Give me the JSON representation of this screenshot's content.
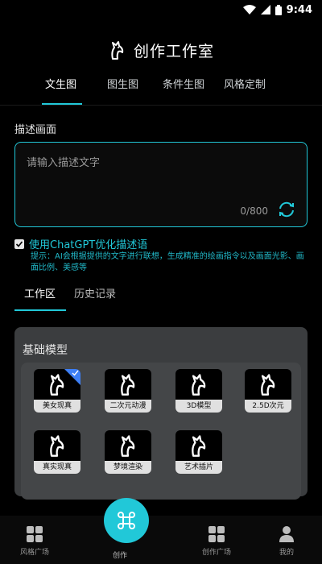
{
  "status_bar": {
    "time": "9:44"
  },
  "header": {
    "title": "创作工作室"
  },
  "tabs": [
    {
      "label": "文生图",
      "active": true
    },
    {
      "label": "图生图",
      "active": false
    },
    {
      "label": "条件生图",
      "active": false
    },
    {
      "label": "风格定制",
      "active": false
    }
  ],
  "description": {
    "section_label": "描述画面",
    "placeholder": "请输入描述文字",
    "value": "",
    "counter": "0/800"
  },
  "optimize": {
    "checked": true,
    "label": "使用ChatGPT优化描述语",
    "hint": "提示：AI会根据提供的文字进行联想，生成精准的绘画指令以及画面光影、画面比例、美感等"
  },
  "work_tabs": [
    {
      "label": "工作区",
      "active": true
    },
    {
      "label": "历史记录",
      "active": false
    }
  ],
  "models": {
    "title": "基础模型",
    "items": [
      {
        "label": "美女现真",
        "selected": true
      },
      {
        "label": "二次元动漫",
        "selected": false
      },
      {
        "label": "3D模型",
        "selected": false
      },
      {
        "label": "2.5D次元",
        "selected": false
      },
      {
        "label": "真实现真",
        "selected": false
      },
      {
        "label": "梦境渲染",
        "selected": false
      },
      {
        "label": "艺术插片",
        "selected": false
      }
    ]
  },
  "bottom_nav": {
    "items": [
      {
        "label": "风格广场",
        "icon": "grid-icon"
      },
      {
        "label": "创作",
        "icon": "command-icon"
      },
      {
        "label": "创作广场",
        "icon": "grid-icon"
      },
      {
        "label": "我的",
        "icon": "person-icon"
      }
    ]
  },
  "colors": {
    "accent": "#21c8d8",
    "selected_badge": "#3d7ff5",
    "panel": "#3b3d3f"
  }
}
